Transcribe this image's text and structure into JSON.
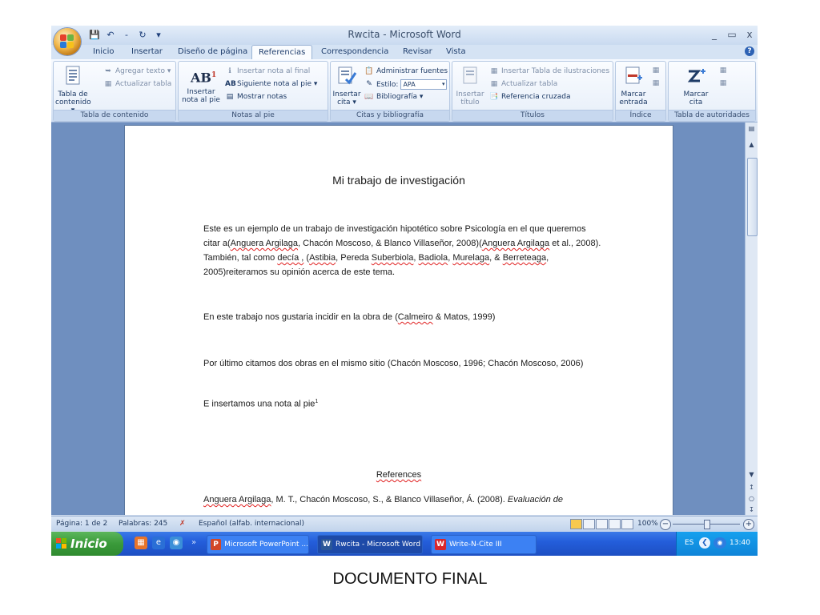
{
  "window": {
    "title": "Rwcita - Microsoft Word",
    "controls": {
      "minimize": "_",
      "maximize": "▭",
      "close": "x"
    },
    "qat": {
      "redo_sep": "-"
    }
  },
  "tabs": [
    "Inicio",
    "Insertar",
    "Diseño de página",
    "Referencias",
    "Correspondencia",
    "Revisar",
    "Vista"
  ],
  "ribbon": {
    "toc": {
      "label": "Tabla de contenido",
      "big_line1": "Tabla de",
      "big_line2": "contenido ▾",
      "add_text": "Agregar texto ▾",
      "update_table": "Actualizar tabla"
    },
    "footnotes": {
      "label": "Notas al pie",
      "insert_line1": "Insertar",
      "insert_line2": "nota al pie",
      "insert_endnote": "Insertar nota al final",
      "next_footnote": "Siguiente nota al pie ▾",
      "show_notes": "Mostrar notas",
      "ab_glyph": "AB",
      "ab_sup": "1"
    },
    "citations": {
      "label": "Citas y bibliografía",
      "insert_line1": "Insertar",
      "insert_line2": "cita ▾",
      "manage_sources": "Administrar fuentes",
      "style_label": "Estilo:",
      "style_value": "APA",
      "bibliography": "Bibliografía ▾"
    },
    "captions": {
      "label": "Títulos",
      "insert_line1": "Insertar",
      "insert_line2": "título",
      "insert_figures_table": "Insertar Tabla de ilustraciones",
      "update_table": "Actualizar tabla",
      "cross_reference": "Referencia cruzada"
    },
    "index": {
      "label": "Índice",
      "mark_line1": "Marcar",
      "mark_line2": "entrada"
    },
    "authorities": {
      "label": "Tabla de autoridades",
      "mark_line1": "Marcar",
      "mark_line2": "cita"
    }
  },
  "document": {
    "title": "Mi trabajo de investigación",
    "p1": {
      "t1": "Este es un ejemplo de un trabajo de investigación hipotético sobre Psicología en el que queremos citar a(",
      "c1": "Anguera Argilaga",
      "t2": ", Chacón Moscoso, & Blanco Villaseñor, 2008)(",
      "c2": "Anguera Argilaga",
      "t3": " et al., 2008). También, tal como ",
      "c3": "decía ,",
      "t4": " (",
      "c4": "Astibia",
      "t5": ", Pereda ",
      "c5": "Suberbiola",
      "t6": ", ",
      "c6": "Badiola",
      "t7": ", ",
      "c7": "Murelaga",
      "t8": ", & ",
      "c8": "Berreteaga",
      "t9": ", 2005)reiteramos su opinión acerca de este tema."
    },
    "p2": {
      "t1": "En este trabajo nos gustaria incidir en la obra de (",
      "c1": "Calmeiro",
      "t2": " & Matos, 1999)"
    },
    "p3": "Por último citamos dos obras en el mismo sitio  (Chacón Moscoso, 1996; Chacón Moscoso, 2006)",
    "p4": {
      "text": "E insertamos una nota al pie",
      "sup": "1"
    },
    "refs_title": "References",
    "ref1": {
      "c1": "Anguera Argilaga",
      "t1": ", M. T., Chacón Moscoso, S., & Blanco Villaseñor, Á. (2008). ",
      "italic": "Evaluación de"
    }
  },
  "statusbar": {
    "page": "Página: 1 de 2",
    "words": "Palabras: 245",
    "language": "Español (alfab. internacional)",
    "zoom": "100%",
    "zoom_minus": "−",
    "zoom_plus": "+"
  },
  "taskbar": {
    "start": "Inicio",
    "apps": [
      "Microsoft PowerPoint ...",
      "Rwcita - Microsoft Word",
      "Write-N-Cite III"
    ],
    "lang": "ES",
    "time": "13:40"
  },
  "caption": "DOCUMENTO FINAL",
  "colors": {
    "ribbon_blue": "#cfdcee",
    "doc_bg": "#6f8fbf",
    "taskbar": "#245edb",
    "start": "#3a9a3a",
    "spell_red": "#e02020"
  }
}
